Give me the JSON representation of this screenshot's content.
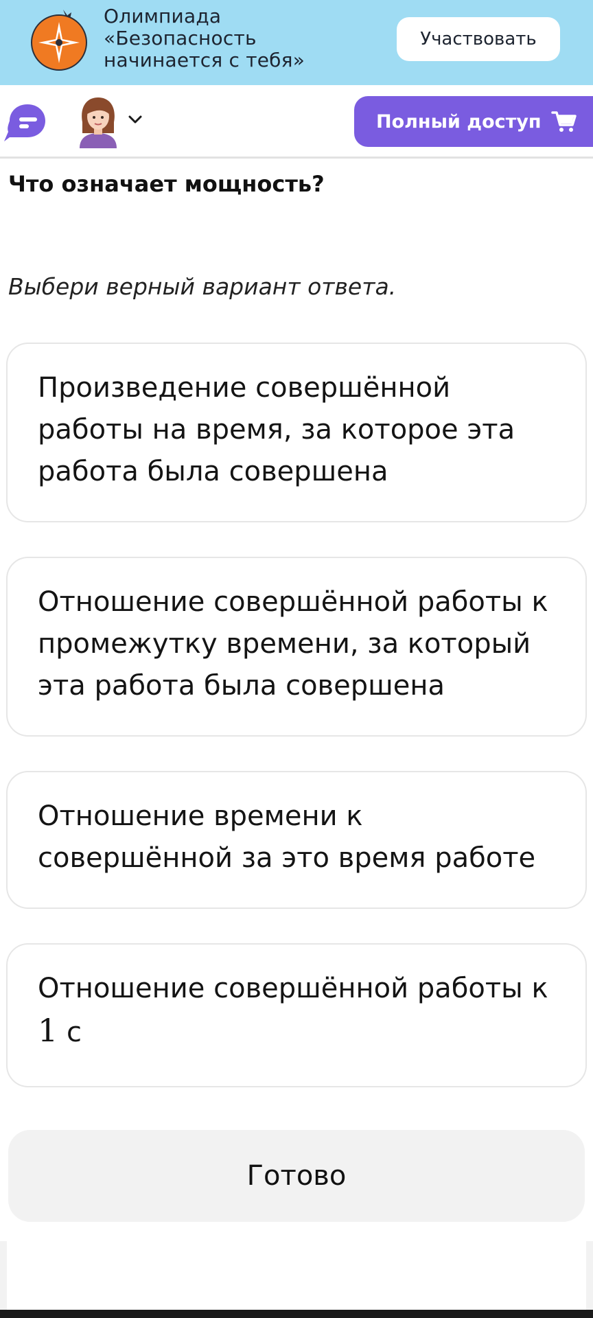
{
  "banner": {
    "title_lines": [
      "Олимпиада",
      "«Безопасность",
      "начинается с тебя»"
    ],
    "participate_label": "Участвовать",
    "logo_icon": "compass-star-icon",
    "background_color": "#9fdcf3",
    "logo_color": "#f07a22"
  },
  "topbar": {
    "chat_icon": "chat-bubble-icon",
    "avatar_icon": "user-avatar-icon",
    "dropdown_icon": "chevron-down-icon",
    "full_access_label": "Полный доступ",
    "cart_icon": "shopping-cart-icon",
    "accent_color": "#7a5ce0"
  },
  "question": {
    "text": "Что означает мощность?",
    "hint": "Выбери верный вариант ответа."
  },
  "options": [
    {
      "lines": [
        "Произведение совершённой",
        "работы на время, за которое эта",
        "работа была совершена"
      ]
    },
    {
      "lines": [
        "Отношение совершённой работы к",
        "промежутку времени, за который",
        "эта работа была совершена"
      ]
    },
    {
      "lines": [
        "Отношение времени к",
        "совершённой за это время работе"
      ]
    },
    {
      "lines": [
        "Отношение совершённой работы к"
      ],
      "formula_number": "1",
      "formula_unit": "с"
    }
  ],
  "done_label": "Готово"
}
